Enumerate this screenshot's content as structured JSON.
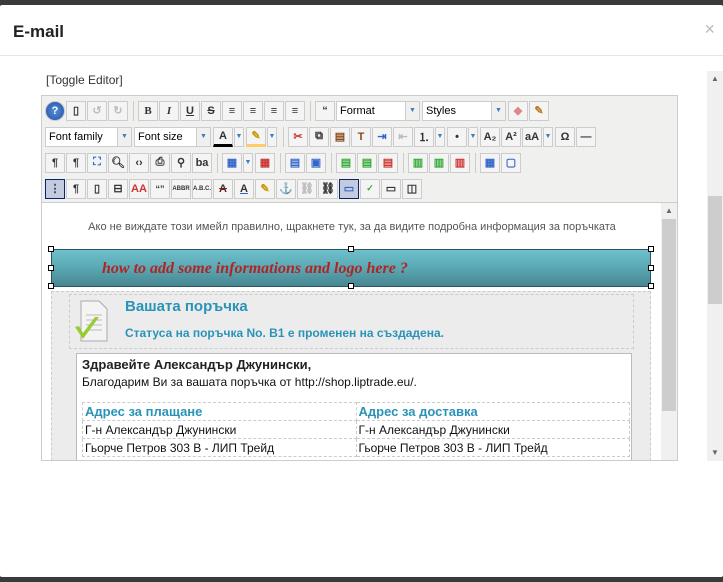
{
  "modal": {
    "title": "E-mail",
    "close": "×"
  },
  "editor": {
    "toggle_label": "[Toggle Editor]",
    "toolbar": {
      "format": "Format",
      "styles": "Styles",
      "font_family": "Font family",
      "font_size": "Font size"
    },
    "content": {
      "notice": "Ако не виждате този имейл правилно, щракнете тук, за да видите подробна информация за поръчката",
      "banner_text": "how to add some informations and logo here ?",
      "order_title": "Вашата поръчка",
      "order_status": "Статуса на поръчка No. B1 е променен на създадена.",
      "greeting": "Здравейте Александър Джунински,",
      "thanks": "Благодарим Ви за вашата поръчка от http://shop.liptrade.eu/.",
      "billing": {
        "heading": "Адрес за плащане",
        "name": "Г-н Александър Джунински",
        "street": "Гьорче Петров 303 B - ЛИП Трейд"
      },
      "shipping": {
        "heading": "Адрес за доставка",
        "name": "Г-н Александър Джунински",
        "street": "Гьорче Петров 303 B - ЛИП Трейд"
      }
    }
  }
}
